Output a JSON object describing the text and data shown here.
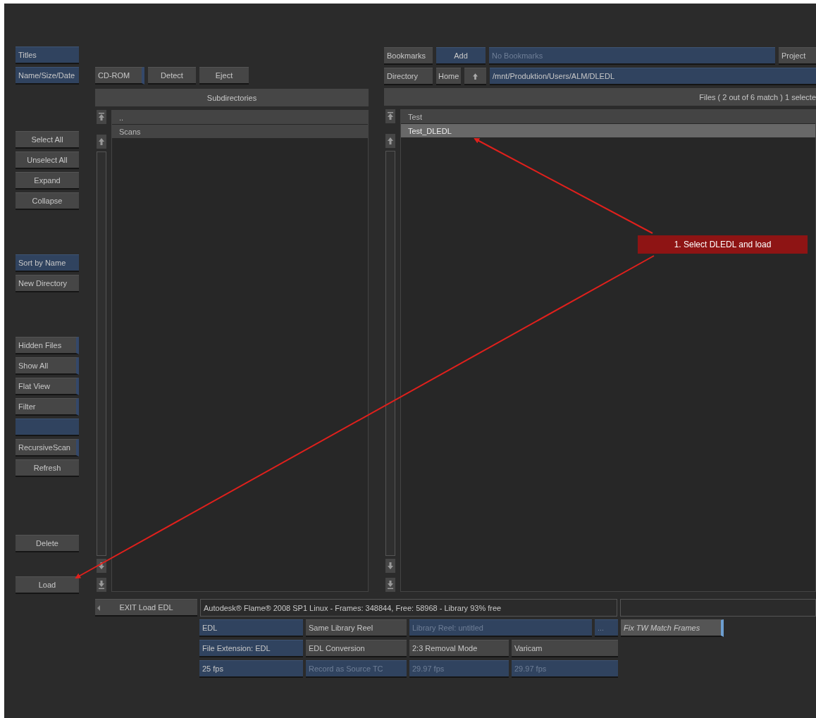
{
  "left_panel": {
    "groups": [
      [
        {
          "label": "Titles",
          "kind": "primary"
        },
        {
          "label": "Name/Size/Date",
          "kind": "primary"
        }
      ],
      [
        {
          "label": "Select All",
          "kind": "plain"
        },
        {
          "label": "Unselect All",
          "kind": "plain"
        },
        {
          "label": "Expand",
          "kind": "plain"
        },
        {
          "label": "Collapse",
          "kind": "plain"
        }
      ],
      [
        {
          "label": "Sort by Name",
          "kind": "primary"
        },
        {
          "label": "New Directory",
          "kind": "plain"
        }
      ],
      [
        {
          "label": "Hidden Files",
          "kind": "toggle"
        },
        {
          "label": "Show All",
          "kind": "toggle"
        },
        {
          "label": "Flat View",
          "kind": "toggle"
        },
        {
          "label": "Filter",
          "kind": "toggle"
        },
        {
          "kind": "field"
        },
        {
          "label": "RecursiveScan",
          "kind": "toggle"
        },
        {
          "label": "Refresh",
          "kind": "plain"
        }
      ],
      [
        {
          "label": "Delete",
          "kind": "plain"
        }
      ],
      [
        {
          "label": "Load",
          "kind": "plain"
        }
      ]
    ]
  },
  "subdirectories": {
    "device_buttons": [
      {
        "label": "CD-ROM",
        "kind": "toggle"
      },
      {
        "label": "Detect",
        "kind": "plain"
      },
      {
        "label": "Eject",
        "kind": "plain"
      }
    ],
    "header": "Subdirectories",
    "rows": [
      {
        "name": "..",
        "selected": false
      },
      {
        "name": "Scans",
        "selected": false
      }
    ]
  },
  "files": {
    "bookmarks": {
      "label": "Bookmarks",
      "add": "Add",
      "placeholder": "No Bookmarks",
      "project": "Project"
    },
    "directory": {
      "label": "Directory",
      "home": "Home",
      "path": "/mnt/Produktion/Users/ALM/DLEDL"
    },
    "header": "Files  ( 2 out of 6 match )  1 selecte",
    "rows": [
      {
        "name": "Test",
        "selected": false
      },
      {
        "name": "Test_DLEDL",
        "selected": true
      }
    ]
  },
  "bottom": {
    "exit": "EXIT Load EDL",
    "status": "Autodesk® Flame® 2008 SP1  Linux - Frames: 348844, Free: 58968 - Library 93% free",
    "rows": [
      [
        {
          "label": "EDL",
          "kind": "primary",
          "disabled": false
        },
        {
          "label": "Same Library Reel",
          "kind": "plain",
          "disabled": false
        },
        {
          "label": "Library Reel: untitled",
          "kind": "primary",
          "disabled": true
        },
        {
          "label": "...",
          "kind": "primary",
          "disabled": true
        },
        {
          "label": "Fix TW Match Frames",
          "kind": "option",
          "disabled": false
        }
      ],
      [
        {
          "label": "File Extension: EDL",
          "kind": "primary",
          "disabled": false
        },
        {
          "label": "EDL Conversion",
          "kind": "plain",
          "disabled": false
        },
        {
          "label": "2:3 Removal Mode",
          "kind": "plain",
          "disabled": false
        },
        {
          "label": "Varicam",
          "kind": "plain",
          "disabled": false
        }
      ],
      [
        {
          "label": "25 fps",
          "kind": "primary",
          "disabled": false
        },
        {
          "label": "Record as Source TC",
          "kind": "primary",
          "disabled": true
        },
        {
          "label": "29.97 fps",
          "kind": "primary",
          "disabled": true
        },
        {
          "label": "29.97 fps",
          "kind": "primary",
          "disabled": true
        }
      ]
    ]
  },
  "annotation": {
    "callout": "1. Select DLEDL and load"
  }
}
